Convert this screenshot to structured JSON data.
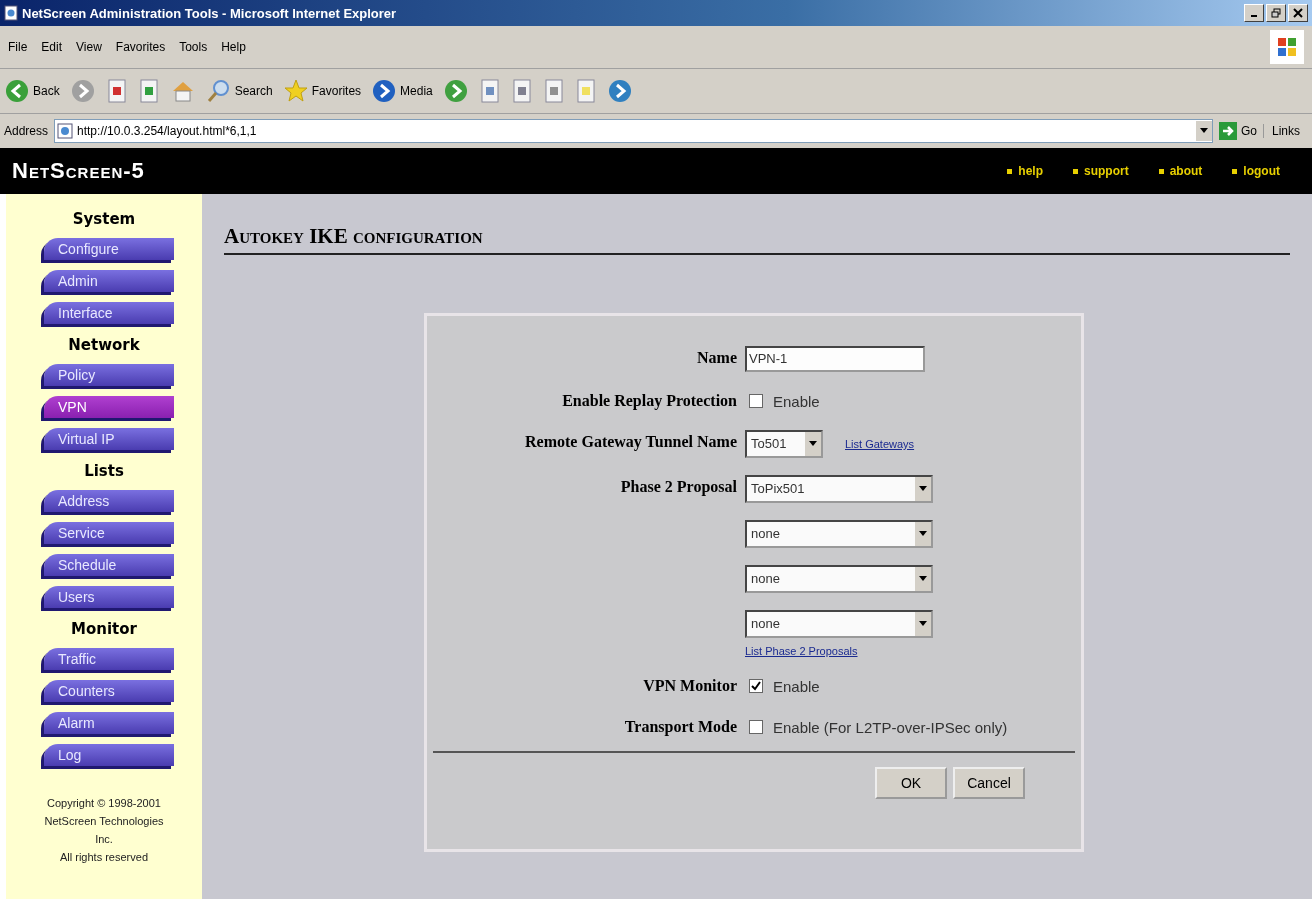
{
  "window": {
    "title": "NetScreen Administration Tools - Microsoft Internet Explorer"
  },
  "menu": [
    "File",
    "Edit",
    "View",
    "Favorites",
    "Tools",
    "Help"
  ],
  "toolbar": [
    {
      "kind": "back",
      "label": "Back"
    },
    {
      "kind": "forward"
    },
    {
      "kind": "stop"
    },
    {
      "kind": "refresh"
    },
    {
      "kind": "home"
    },
    {
      "kind": "search",
      "label": "Search"
    },
    {
      "kind": "favorites",
      "label": "Favorites"
    },
    {
      "kind": "media",
      "label": "Media"
    },
    {
      "kind": "history"
    },
    {
      "kind": "mail"
    },
    {
      "kind": "print"
    },
    {
      "kind": "edit"
    },
    {
      "kind": "note"
    },
    {
      "kind": "messenger"
    }
  ],
  "address": {
    "label": "Address",
    "url": "http://10.0.3.254/layout.html*6,1,1",
    "go": "Go",
    "links": "Links"
  },
  "header": {
    "brand": "NetScreen-5",
    "links": [
      "help",
      "support",
      "about",
      "logout"
    ]
  },
  "sidebar": [
    {
      "heading": "System",
      "items": [
        {
          "label": "Configure",
          "selected": false
        },
        {
          "label": "Admin",
          "selected": false
        },
        {
          "label": "Interface",
          "selected": false
        }
      ]
    },
    {
      "heading": "Network",
      "items": [
        {
          "label": "Policy",
          "selected": false
        },
        {
          "label": "VPN",
          "selected": true
        },
        {
          "label": "Virtual IP",
          "selected": false
        }
      ]
    },
    {
      "heading": "Lists",
      "items": [
        {
          "label": "Address",
          "selected": false
        },
        {
          "label": "Service",
          "selected": false
        },
        {
          "label": "Schedule",
          "selected": false
        },
        {
          "label": "Users",
          "selected": false
        }
      ]
    },
    {
      "heading": "Monitor",
      "items": [
        {
          "label": "Traffic",
          "selected": false
        },
        {
          "label": "Counters",
          "selected": false
        },
        {
          "label": "Alarm",
          "selected": false
        },
        {
          "label": "Log",
          "selected": false
        }
      ]
    }
  ],
  "copyright": [
    "Copyright © 1998-2001",
    "NetScreen Technologies",
    "Inc.",
    "All rights reserved"
  ],
  "page_title": "Autokey IKE configuration",
  "form": [
    {
      "kind": "text",
      "label": "Name",
      "value": "VPN-1"
    },
    {
      "kind": "checkbox",
      "label": "Enable Replay Protection",
      "checked": false,
      "option": "Enable"
    },
    {
      "kind": "select",
      "label": "Remote Gateway Tunnel Name",
      "value": "To501",
      "link": "List Gateways"
    },
    {
      "kind": "selects",
      "label": "Phase 2 Proposal",
      "values": [
        "ToPix501",
        "none",
        "none",
        "none"
      ],
      "link": "List Phase 2 Proposals"
    },
    {
      "kind": "checkbox",
      "label": "VPN Monitor",
      "checked": true,
      "option": "Enable"
    },
    {
      "kind": "checkbox",
      "label": "Transport Mode",
      "checked": false,
      "option": "Enable (For L2TP-over-IPSec only)"
    }
  ],
  "buttons": [
    "OK",
    "Cancel"
  ]
}
